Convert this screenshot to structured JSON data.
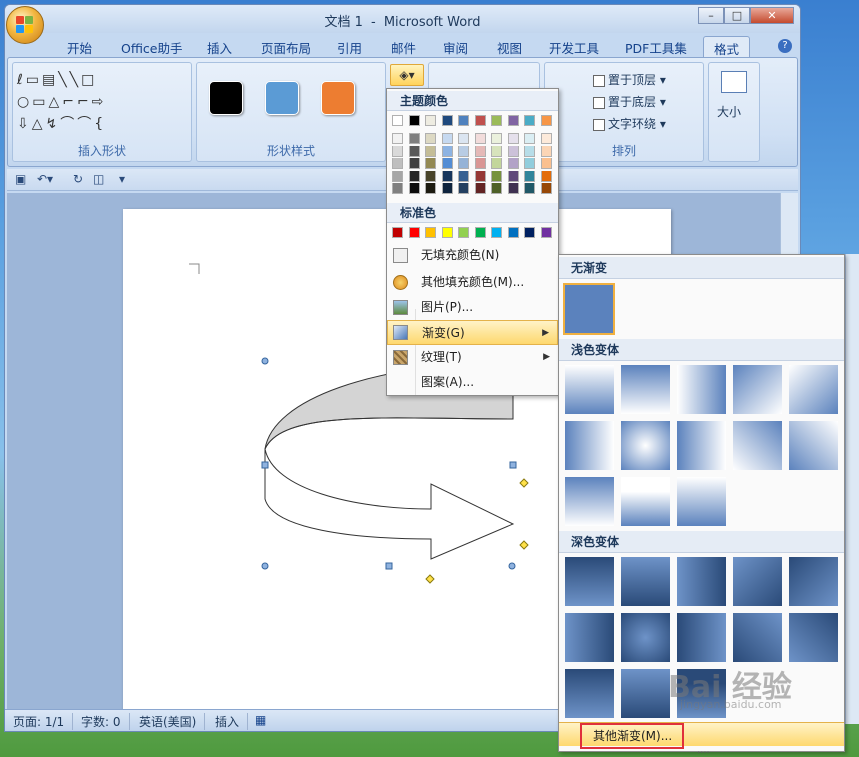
{
  "window": {
    "title_doc": "文档 1",
    "title_sep": "-",
    "title_app": "Microsoft Word",
    "controls": [
      "–",
      "□",
      "✕"
    ]
  },
  "tabs": [
    "开始",
    "Office助手",
    "插入",
    "页面布局",
    "引用",
    "邮件",
    "审阅",
    "视图",
    "开发工具",
    "PDF工具集",
    "格式"
  ],
  "ribbon": {
    "groups": {
      "insert_shapes": "插入形状",
      "shape_styles": "形状样式",
      "arrange": "排列",
      "size": "大小"
    },
    "arrange_items": [
      "置于顶层",
      "置于底层",
      "文字环绕"
    ],
    "partial_label": "置",
    "style_swatch_colors": [
      "#000000",
      "#5b9bd5",
      "#ed7d31"
    ]
  },
  "color_menu": {
    "theme_heading": "主题颜色",
    "standard_heading": "标准色",
    "theme_top_row": [
      "#ffffff",
      "#000000",
      "#eeece1",
      "#1f497d",
      "#4f81bd",
      "#c0504d",
      "#9bbb59",
      "#8064a2",
      "#4bacc6",
      "#f79646"
    ],
    "theme_columns": [
      [
        "#f2f2f2",
        "#d9d9d9",
        "#bfbfbf",
        "#a6a6a6",
        "#808080"
      ],
      [
        "#7f7f7f",
        "#595959",
        "#404040",
        "#262626",
        "#0d0d0d"
      ],
      [
        "#ddd9c3",
        "#c4bd97",
        "#938953",
        "#494429",
        "#1d1b10"
      ],
      [
        "#c6d9f0",
        "#8db3e2",
        "#548dd4",
        "#17365d",
        "#0f243e"
      ],
      [
        "#dbe5f1",
        "#b8cce4",
        "#95b3d7",
        "#366092",
        "#244061"
      ],
      [
        "#f2dcdb",
        "#e5b9b7",
        "#d99694",
        "#953734",
        "#632423"
      ],
      [
        "#ebf1dd",
        "#d7e3bc",
        "#c3d69b",
        "#76923c",
        "#4f6128"
      ],
      [
        "#e5e0ec",
        "#ccc1d9",
        "#b2a2c7",
        "#5f497a",
        "#3f3151"
      ],
      [
        "#dbeef3",
        "#b7dde8",
        "#92cddc",
        "#31859b",
        "#205867"
      ],
      [
        "#fdeada",
        "#fbd5b5",
        "#fac08f",
        "#e36c09",
        "#974806"
      ]
    ],
    "standard_colors": [
      "#c00000",
      "#ff0000",
      "#ffc000",
      "#ffff00",
      "#92d050",
      "#00b050",
      "#00b0f0",
      "#0070c0",
      "#002060",
      "#7030a0"
    ],
    "items": [
      {
        "label": "无填充颜色(N)",
        "icon": "no-fill-icon"
      },
      {
        "label": "其他填充颜色(M)...",
        "icon": "palette-icon"
      },
      {
        "label": "图片(P)...",
        "icon": "picture-icon"
      },
      {
        "label": "渐变(G)",
        "icon": "gradient-icon"
      },
      {
        "label": "纹理(T)",
        "icon": "texture-icon"
      },
      {
        "label": "图案(A)...",
        "icon": "pattern-icon"
      }
    ]
  },
  "gradient_panel": {
    "no_gradient": "无渐变",
    "light_variations": "浅色变体",
    "dark_variations": "深色变体",
    "more": "其他渐变(M)...",
    "ellipsis": "....",
    "base_color": "#5b82bd"
  },
  "status": {
    "page": "页面: 1/1",
    "words": "字数: 0",
    "lang": "英语(美国)",
    "mode": "插入"
  },
  "watermark": {
    "text": "Bai 经验",
    "sub": "jingyan.baidu.com"
  }
}
